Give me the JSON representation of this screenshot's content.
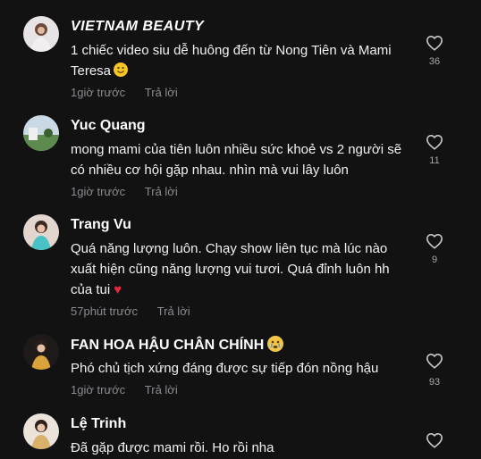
{
  "comments": [
    {
      "username": "VIETNAM BEAUTY",
      "text": "1 chiếc video siu dễ huông đến từ Nong Tiên và Mami Teresa",
      "emoji": "smiling-face",
      "time": "1giờ trước",
      "reply": "Trả lời",
      "likes": "36"
    },
    {
      "username": "Yuc Quang",
      "text": "mong mami của tiên luôn nhiều sức khoẻ vs 2 người sẽ có nhiều cơ hội gặp nhau. nhìn mà vui lây luôn",
      "time": "1giờ trước",
      "reply": "Trả lời",
      "likes": "11"
    },
    {
      "username": "Trang Vu",
      "text": "Quá năng lượng luôn. Chạy show liên tục mà lúc nào xuất hiện cũng năng lượng vui tươi. Quá đỉnh luôn hh của tui",
      "emoji": "red-heart",
      "time": "57phút trước",
      "reply": "Trả lời",
      "likes": "9"
    },
    {
      "username": "FAN HOA HẬU CHÂN CHÍNH",
      "emoji": "crying-face",
      "text": "Phó chủ tịch xứng đáng được sự tiếp đón nồng hậu",
      "time": "1giờ trước",
      "reply": "Trả lời",
      "likes": "93"
    },
    {
      "username": "Lệ Trinh",
      "text": "Đã gặp được mami rồi. Ho rồi nha",
      "time": "",
      "reply": "",
      "likes": ""
    }
  ],
  "colors": {
    "background": "#121212",
    "secondary_text": "#8a8b91",
    "heart_outline": "#c8c8cc"
  }
}
